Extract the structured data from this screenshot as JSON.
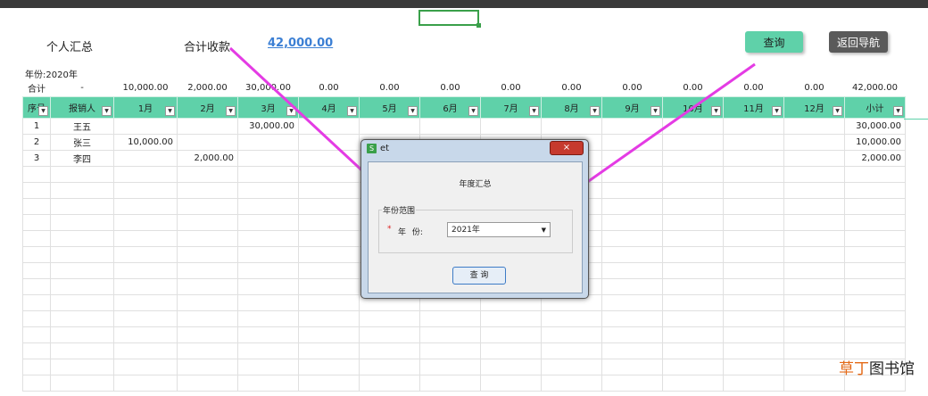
{
  "header": {
    "personal_summary": "个人汇总",
    "total_received_label": "合计收款",
    "total_received_value": "42,000.00",
    "query_button": "查询",
    "back_button": "返回导航",
    "year_line": "年份:2020年"
  },
  "sum_row": [
    "合计",
    "-",
    "10,000.00",
    "2,000.00",
    "30,000.00",
    "0.00",
    "0.00",
    "0.00",
    "0.00",
    "0.00",
    "0.00",
    "0.00",
    "0.00",
    "0.00",
    "42,000.00"
  ],
  "columns": [
    "序号",
    "报销人",
    "1月",
    "2月",
    "3月",
    "4月",
    "5月",
    "6月",
    "7月",
    "8月",
    "9月",
    "10月",
    "11月",
    "12月",
    "小计"
  ],
  "rows": [
    [
      "1",
      "王五",
      "",
      "",
      "30,000.00",
      "",
      "",
      "",
      "",
      "",
      "",
      "",
      "",
      "",
      "30,000.00"
    ],
    [
      "2",
      "张三",
      "10,000.00",
      "",
      "",
      "",
      "",
      "",
      "",
      "",
      "",
      "",
      "",
      "",
      "10,000.00"
    ],
    [
      "3",
      "李四",
      "",
      "2,000.00",
      "",
      "",
      "",
      "",
      "",
      "",
      "",
      "",
      "",
      "",
      "2,000.00"
    ]
  ],
  "dialog": {
    "title": "et",
    "icon_letter": "S",
    "close": "×",
    "heading": "年度汇总",
    "group_label": "年份范围",
    "required_mark": "*",
    "year_label": "年 份:",
    "year_value": "2021年",
    "query_button": "查 询"
  },
  "colors": {
    "accent": "#5fd1a9",
    "link": "#3b7fd4",
    "arrow": "#e43be4"
  },
  "watermark": {
    "orange": "草丁",
    "rest": "图书馆"
  }
}
